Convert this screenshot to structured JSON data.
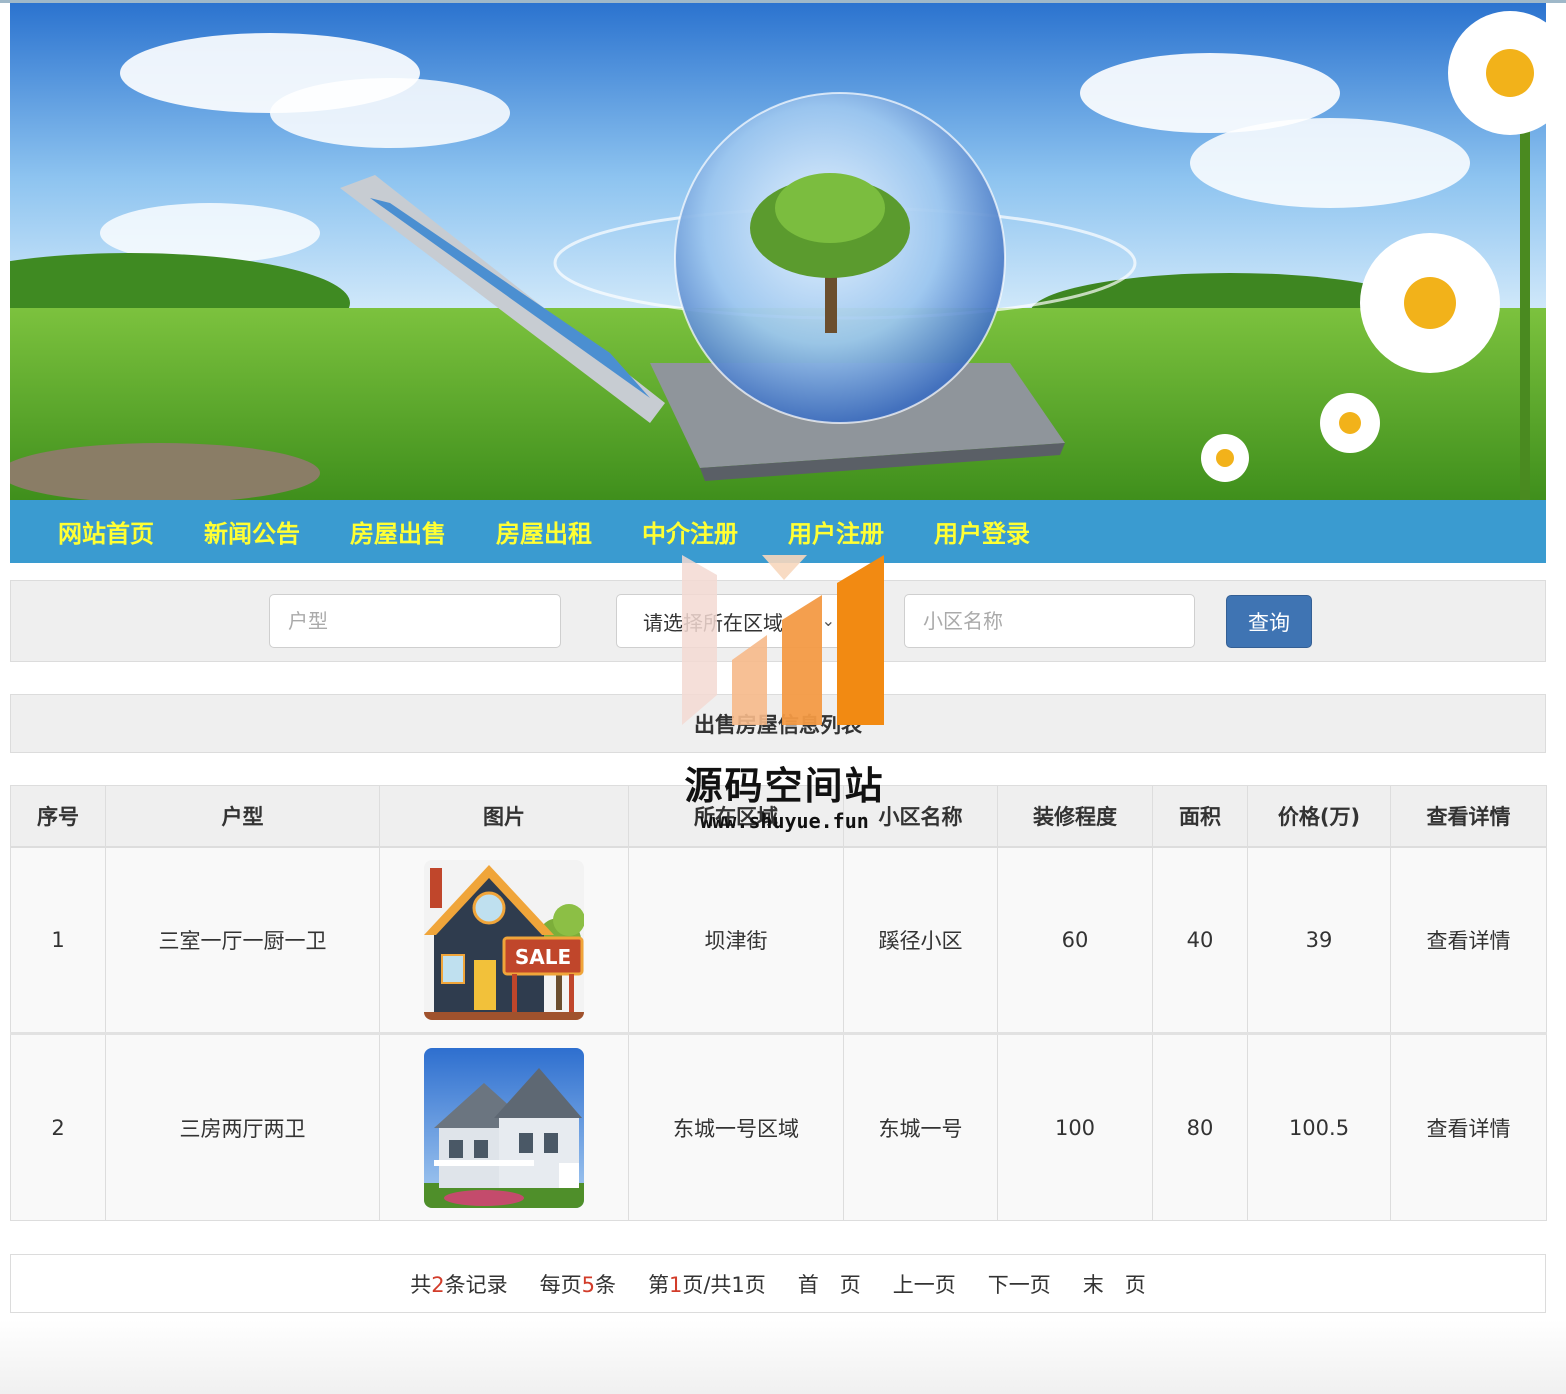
{
  "nav": {
    "items": [
      "网站首页",
      "新闻公告",
      "房屋出售",
      "房屋出租",
      "中介注册",
      "用户注册",
      "用户登录"
    ]
  },
  "search": {
    "house_type_placeholder": "户型",
    "region_select_value": "请选择所在区域",
    "community_placeholder": "小区名称",
    "query_button": "查询"
  },
  "list": {
    "title": "出售房屋信息列表",
    "columns": [
      "序号",
      "户型",
      "图片",
      "所在区域",
      "小区名称",
      "装修程度",
      "面积",
      "价格(万)",
      "查看详情"
    ],
    "rows": [
      {
        "index": "1",
        "house_type": "三室一厅一厨一卫",
        "image": "sale-house-illustration",
        "region": "坝津街",
        "community": "蹊径小区",
        "decoration": "60",
        "area": "40",
        "price": "39",
        "detail": "查看详情"
      },
      {
        "index": "2",
        "house_type": "三房两厅两卫",
        "image": "house-photo",
        "region": "东城一号区域",
        "community": "东城一号",
        "decoration": "100",
        "area": "80",
        "price": "100.5",
        "detail": "查看详情"
      }
    ]
  },
  "pager": {
    "total_prefix": "共",
    "total": "2",
    "total_suffix": "条记录",
    "per_page_prefix": "每页",
    "per_page": "5",
    "per_page_suffix": "条",
    "page_prefix": "第",
    "page": "1",
    "page_suffix": "页/共1页",
    "first": "首　页",
    "prev": "上一页",
    "next": "下一页",
    "last": "末　页"
  },
  "sale_sign": "SALE",
  "watermark": {
    "title": "源码空间站",
    "url": "www.shuyue.fun"
  },
  "colors": {
    "nav_bg": "#3a9bd0",
    "nav_text": "#ffff33",
    "button": "#3f74b3",
    "pager_highlight": "#d23c2a"
  }
}
